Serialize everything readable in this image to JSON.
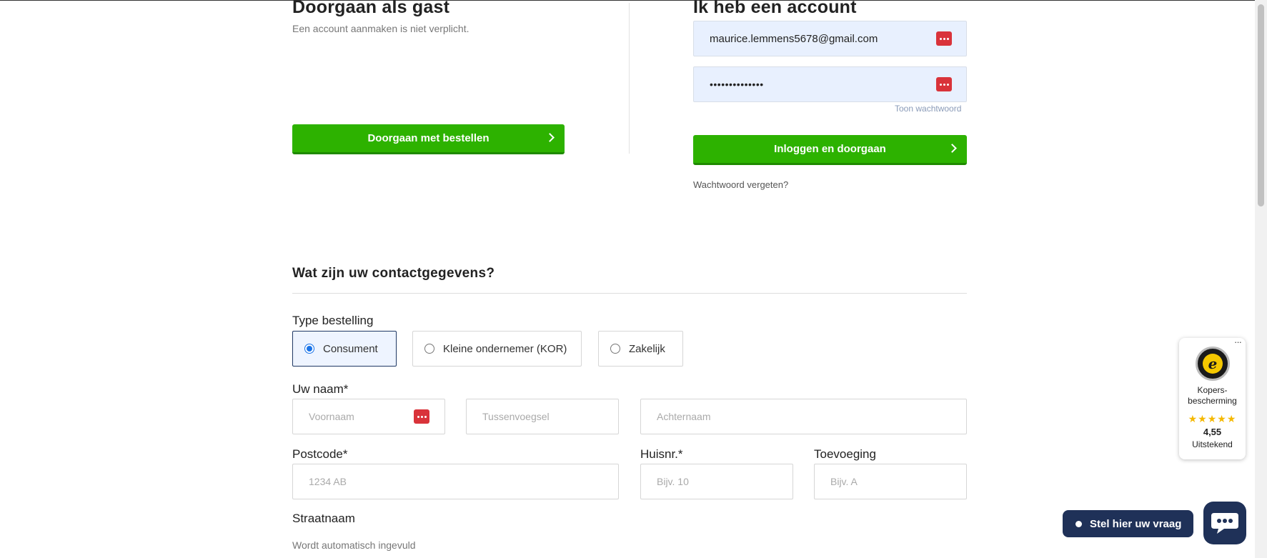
{
  "guest": {
    "title": "Doorgaan als gast",
    "subtitle": "Een account aanmaken is niet verplicht.",
    "button_label": "Doorgaan met bestellen"
  },
  "account": {
    "title": "Ik heb een account",
    "email_value": "maurice.lemmens5678@gmail.com",
    "password_value": "••••••••••••••",
    "show_password_label": "Toon wachtwoord",
    "login_button_label": "Inloggen en doorgaan",
    "forgot_password_label": "Wachtwoord vergeten?"
  },
  "contact": {
    "heading": "Wat zijn uw contactgegevens?",
    "order_type_label": "Type bestelling",
    "order_types": [
      {
        "label": "Consument",
        "selected": true
      },
      {
        "label": "Kleine ondernemer (KOR)",
        "selected": false
      },
      {
        "label": "Zakelijk",
        "selected": false
      }
    ],
    "name_label": "Uw naam*",
    "first_name_placeholder": "Voornaam",
    "infix_placeholder": "Tussenvoegsel",
    "last_name_placeholder": "Achternaam",
    "postcode_label": "Postcode*",
    "postcode_placeholder": "1234 AB",
    "house_number_label": "Huisnr.*",
    "house_number_placeholder": "Bijv. 10",
    "addition_label": "Toevoeging",
    "addition_placeholder": "Bijv. A",
    "street_label": "Straatnaam",
    "street_helper": "Wordt automatisch ingevuld"
  },
  "trust_badge": {
    "line1": "Kopers-",
    "line2": "bescherming",
    "stars": "★★★★★",
    "score": "4,55",
    "verdict": "Uitstekend",
    "more": "···"
  },
  "chat": {
    "label": "Stel hier uw vraag"
  },
  "colors": {
    "primary_green": "#2db200",
    "autofill_blue": "#e8f0fe",
    "navy": "#1f3158",
    "password_manager_red": "#d9333a"
  }
}
